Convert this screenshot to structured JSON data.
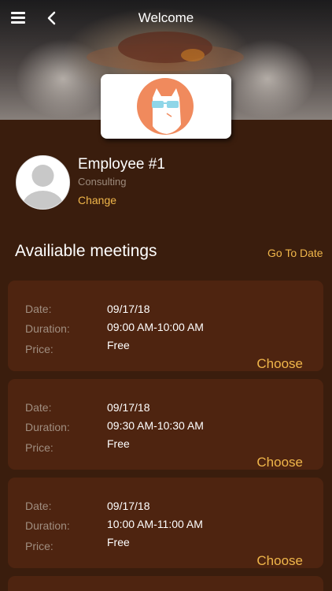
{
  "header": {
    "title": "Welcome",
    "menu_icon": "hamburger-menu-icon",
    "back_icon": "chevron-left-icon"
  },
  "colors": {
    "background": "#3a1d0d",
    "card": "#4e2410",
    "accent": "#f0b64a",
    "logo_orange": "#f08a5d"
  },
  "profile": {
    "name": "Employee #1",
    "department": "Consulting",
    "change_label": "Change"
  },
  "meetings_section": {
    "title": "Availiable meetings",
    "go_to_date_label": "Go To Date"
  },
  "meetings": [
    {
      "date_label": "Date:",
      "date": "09/17/18",
      "duration_label": "Duration:",
      "duration": "09:00 AM-10:00 AM",
      "price_label": "Price:",
      "price": "Free",
      "choose_label": "Choose"
    },
    {
      "date_label": "Date:",
      "date": "09/17/18",
      "duration_label": "Duration:",
      "duration": "09:30 AM-10:30 AM",
      "price_label": "Price:",
      "price": "Free",
      "choose_label": "Choose"
    },
    {
      "date_label": "Date:",
      "date": "09/17/18",
      "duration_label": "Duration:",
      "duration": "10:00 AM-11:00 AM",
      "price_label": "Price:",
      "price": "Free",
      "choose_label": "Choose"
    }
  ]
}
